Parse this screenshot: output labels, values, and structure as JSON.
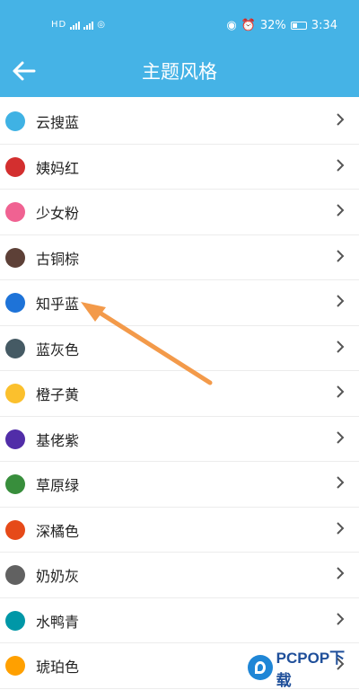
{
  "status_bar": {
    "left_text": "HD",
    "battery": "32%",
    "time": "3:34"
  },
  "app_bar": {
    "title": "主题风格",
    "back_icon": "arrow-left-icon"
  },
  "themes": [
    {
      "label": "云搜蓝",
      "color": "#3fb2e4"
    },
    {
      "label": "姨妈红",
      "color": "#d32f2f"
    },
    {
      "label": "少女粉",
      "color": "#f06292"
    },
    {
      "label": "古铜棕",
      "color": "#5d4037"
    },
    {
      "label": "知乎蓝",
      "color": "#1e73d8"
    },
    {
      "label": "蓝灰色",
      "color": "#455a64"
    },
    {
      "label": "橙子黄",
      "color": "#fbc02d"
    },
    {
      "label": "基佬紫",
      "color": "#512da8"
    },
    {
      "label": "草原绿",
      "color": "#388e3c"
    },
    {
      "label": "深橘色",
      "color": "#e64a19"
    },
    {
      "label": "奶奶灰",
      "color": "#616161"
    },
    {
      "label": "水鸭青",
      "color": "#0097a7"
    },
    {
      "label": "琥珀色",
      "color": "#ffa000"
    }
  ],
  "annotation": {
    "arrow_color": "#f39a4a"
  },
  "watermark": {
    "text": "PCPOP下载"
  }
}
